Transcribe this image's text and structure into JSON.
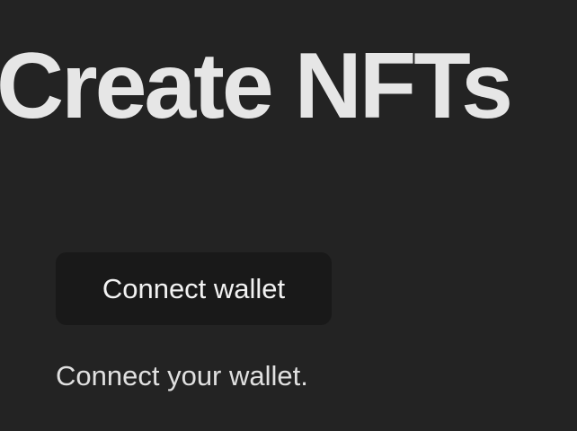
{
  "page": {
    "title": "Create NFTs"
  },
  "wallet": {
    "connect_button_label": "Connect wallet",
    "helper_text": "Connect your wallet."
  },
  "colors": {
    "background": "#232323",
    "button_background": "#191919",
    "title_text": "#e6e6e6",
    "body_text": "#e0e0e0"
  }
}
